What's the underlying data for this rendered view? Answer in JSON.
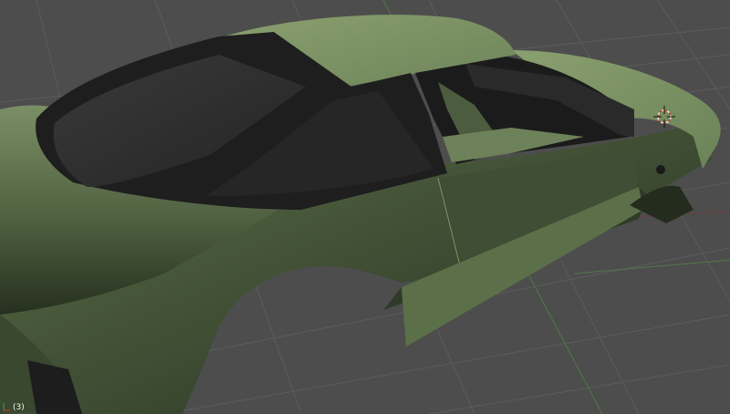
{
  "viewport": {
    "object_info": "(3)",
    "colors": {
      "background": "#4d4d4d",
      "grid_line": "#5a5a5a",
      "grid_axis_x": "#8a3a3a",
      "grid_axis_y": "#4f7a45",
      "body_paint": "#6b7f58",
      "body_shadow": "#26301f",
      "glass": "#2b2b2b",
      "trim": "#1c1c1c",
      "cursor_ring": "#d23a2a"
    },
    "icons": {
      "axis_widget": "axis-gizmo-icon",
      "cursor": "3d-cursor-icon"
    }
  }
}
